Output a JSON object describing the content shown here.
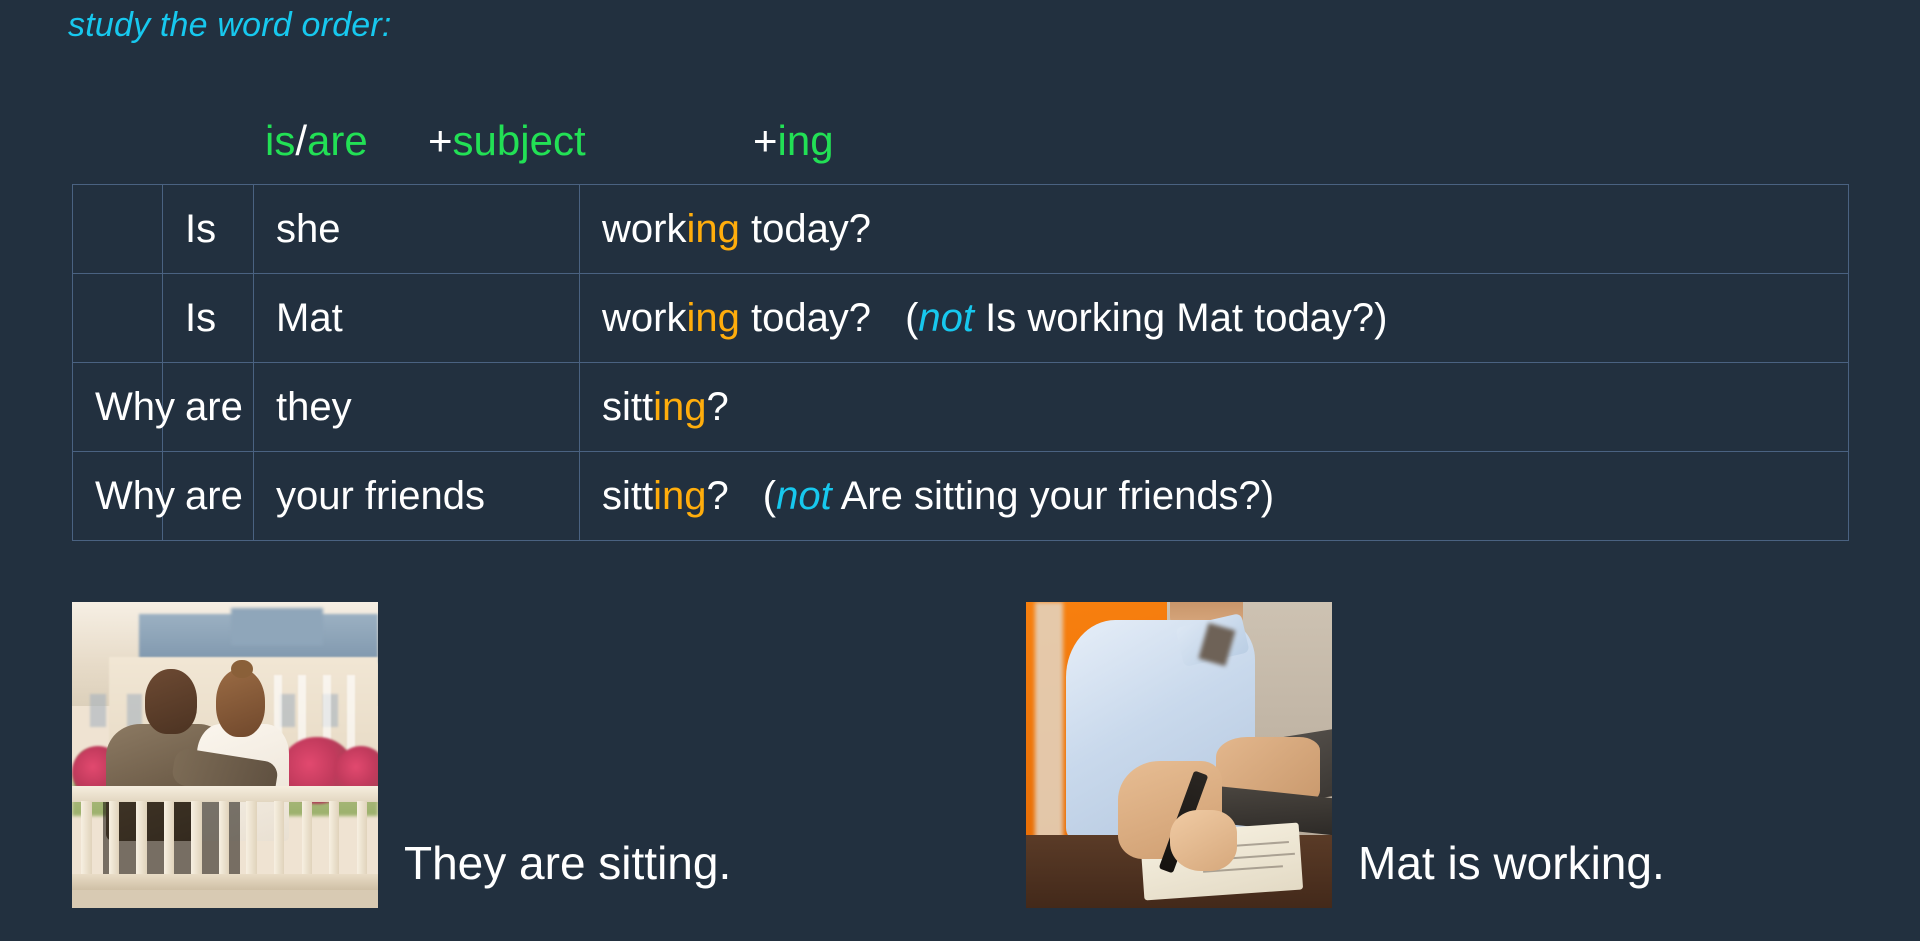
{
  "slide": {
    "title": "study the word order:",
    "background_color": "#22303f"
  },
  "colors": {
    "title_cyan": "#17c8ee",
    "formula_green": "#22e055",
    "aux_orange": "#ffad0c",
    "text_white": "#ffffff",
    "table_border": "#4a6281"
  },
  "formula_header": {
    "col_why": "",
    "aux_is": "is",
    "aux_slash": "/",
    "aux_are": "are",
    "plus_subject_plus": "+",
    "plus_subject_word": "subject",
    "plus_ing_plus": "+",
    "plus_ing_word": "ing"
  },
  "table": {
    "rows": [
      {
        "why": "",
        "aux": "Is",
        "subject": "she",
        "verb_stem": "work",
        "verb_ing": "ing",
        "verb_tail": " today?",
        "note_open": "",
        "note_italic": "",
        "note_rest": ""
      },
      {
        "why": "",
        "aux": "Is",
        "subject": "Mat",
        "verb_stem": "work",
        "verb_ing": "ing",
        "verb_tail": " today?",
        "note_open": "(",
        "note_italic": "not",
        "note_rest": " Is working Mat today?)"
      },
      {
        "why": "Why",
        "aux": "are",
        "subject": "they",
        "verb_stem": "sitt",
        "verb_ing": "ing",
        "verb_tail": "?",
        "note_open": "",
        "note_italic": "",
        "note_rest": ""
      },
      {
        "why": "Why",
        "aux": "are",
        "subject": "your friends",
        "verb_stem": "sitt",
        "verb_ing": "ing",
        "verb_tail": "?",
        "note_open": "(",
        "note_italic": "not",
        "note_rest": " Are sitting your friends?)"
      }
    ]
  },
  "examples": [
    {
      "photo_name": "couple-sitting-on-bench-photo",
      "caption": "They are sitting."
    },
    {
      "photo_name": "man-writing-at-desk-photo",
      "caption": "Mat is working."
    }
  ]
}
